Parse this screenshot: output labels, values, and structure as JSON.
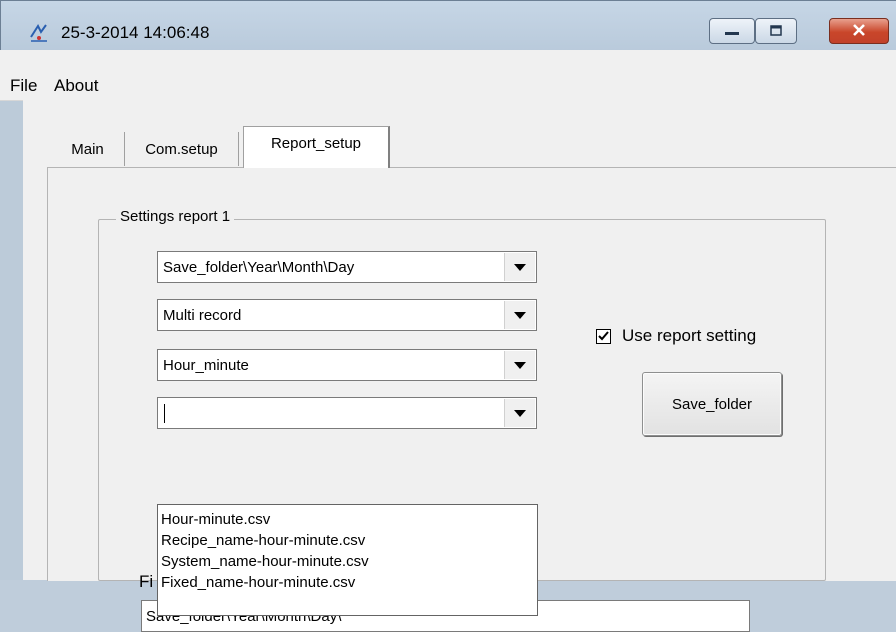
{
  "window": {
    "title": "25-3-2014 14:06:48"
  },
  "menu": {
    "items": [
      "File",
      "About"
    ]
  },
  "tabs": [
    {
      "label": "Main",
      "selected": false
    },
    {
      "label": "Com.setup",
      "selected": false
    },
    {
      "label": "Report_setup",
      "selected": true
    }
  ],
  "settings_group": {
    "label": "Settings report 1",
    "combos": [
      {
        "value": "Save_folder\\Year\\Month\\Day"
      },
      {
        "value": "Multi record"
      },
      {
        "value": "Hour_minute"
      },
      {
        "value": ""
      }
    ],
    "dropdown_options": [
      "Hour-minute.csv",
      "Recipe_name-hour-minute.csv",
      "System_name-hour-minute.csv",
      "Fixed_name-hour-minute.csv"
    ],
    "use_report_setting": {
      "label": "Use report setting",
      "checked": true
    },
    "save_folder_button": "Save_folder",
    "file_label": "Fi",
    "path_value": "Save_folder\\Year\\Month\\Day\\"
  },
  "icons": {
    "app": "app-icon",
    "minimize": "minimize-icon",
    "maximize": "maximize-icon",
    "close": "close-icon",
    "dropdown": "chevron-down-icon",
    "check": "checkmark-icon"
  }
}
